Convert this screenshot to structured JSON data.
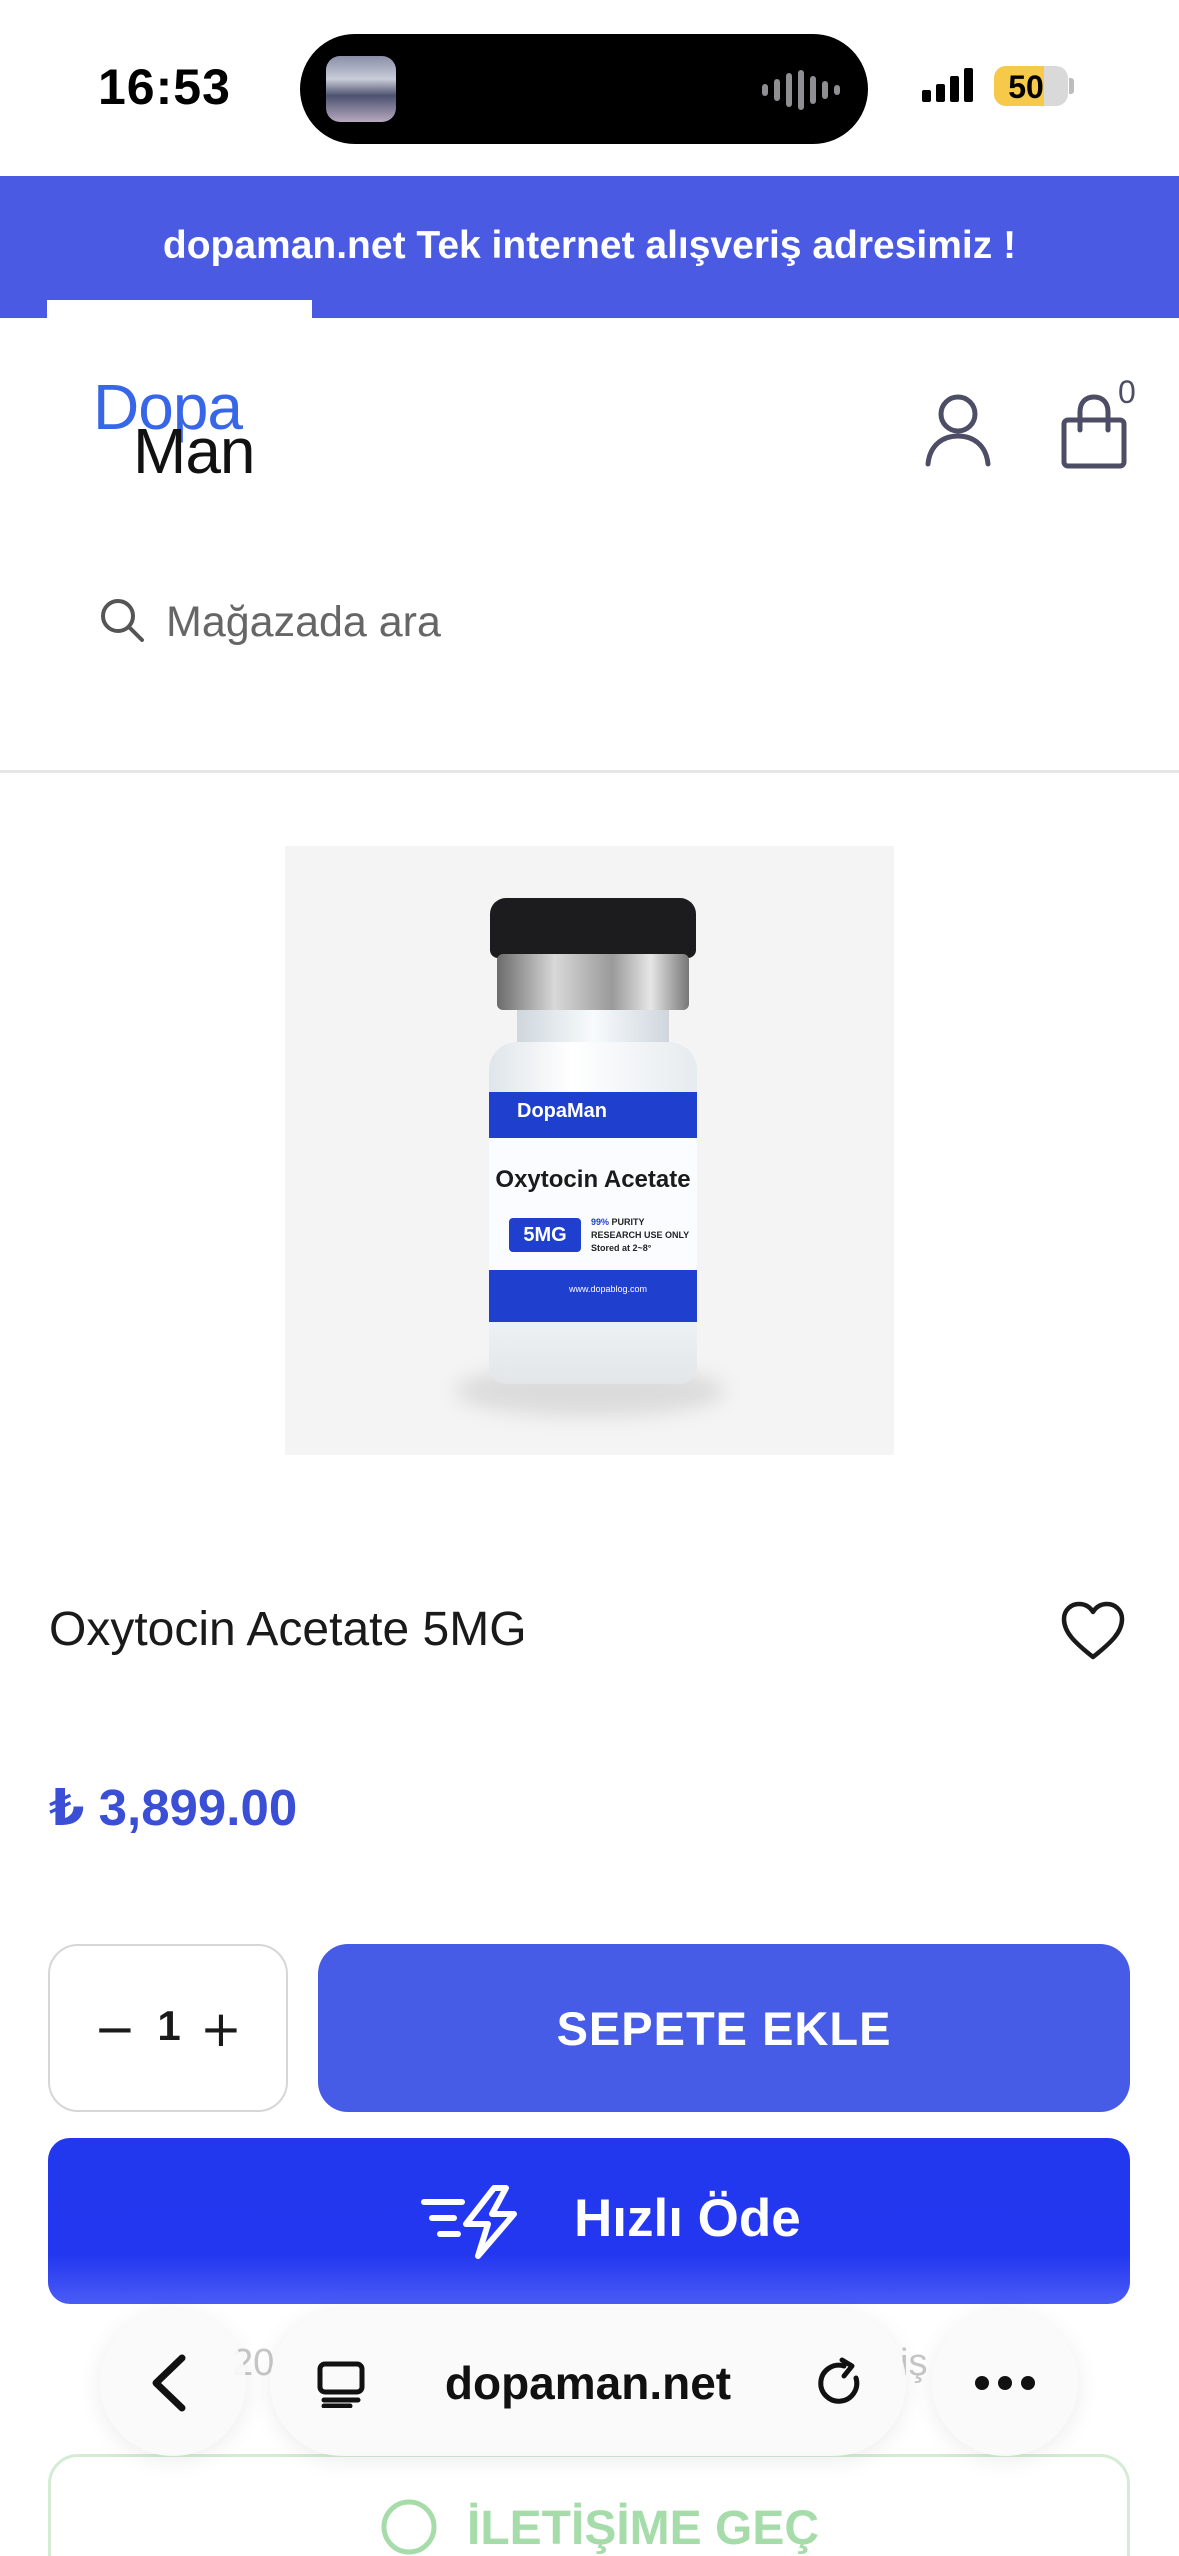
{
  "status_bar": {
    "time": "16:53",
    "battery_level": "50",
    "battery_percent": 50
  },
  "announcement": {
    "text": "dopaman.net Tek internet alışveriş adresimiz !"
  },
  "header": {
    "logo_line1": "Dopa",
    "logo_line2": "Man",
    "cart_count": "0"
  },
  "search": {
    "placeholder": "Mağazada ara"
  },
  "product": {
    "image_label_brand": "DopaMan",
    "image_label_name": "Oxytocin Acetate",
    "image_label_dose": "5MG",
    "image_label_purity_value": "99%",
    "image_label_purity": "PURITY",
    "image_label_use": "RESEARCH USE ONLY",
    "image_label_storage": "Stored at 2~8°",
    "image_label_url": "www.dopablog.com",
    "title": "Oxytocin Acetate 5MG",
    "price": "₺ 3,899.00"
  },
  "purchase": {
    "minus": "−",
    "quantity": "1",
    "plus": "+",
    "add_to_cart": "SEPETE EKLE",
    "quick_pay": "Hızlı Öde"
  },
  "behind_bar": {
    "left_text": "20",
    "right_text": "iş",
    "contact_label": "İLETİŞİME GEÇ"
  },
  "browser": {
    "domain": "dopaman.net"
  },
  "colors": {
    "accent": "#465be6",
    "quick_pay": "#2337f0",
    "price": "#3a4fd6",
    "announcement_bg": "#4a5ae3"
  }
}
